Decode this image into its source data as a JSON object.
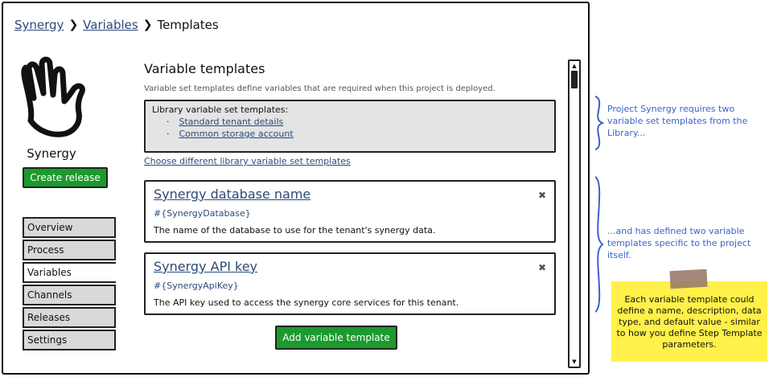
{
  "breadcrumb": {
    "items": [
      "Synergy",
      "Variables"
    ],
    "current": "Templates",
    "separator": "❯"
  },
  "project": {
    "name": "Synergy",
    "create_release_label": "Create release"
  },
  "nav": {
    "items": [
      "Overview",
      "Process",
      "Variables",
      "Channels",
      "Releases",
      "Settings"
    ],
    "active": "Variables"
  },
  "main": {
    "title": "Variable templates",
    "description": "Variable set templates define variables that are required when this project is deployed.",
    "library": {
      "heading": "Library variable set templates:",
      "bullet": "·",
      "items": [
        "Standard tenant details",
        "Common storage account"
      ]
    },
    "choose_link": "Choose different library variable set templates",
    "templates": [
      {
        "name": "Synergy database name",
        "variable": "#{SynergyDatabase}",
        "description": "The name of the database to use for the tenant's synergy data.",
        "close_icon": "✖"
      },
      {
        "name": "Synergy API key",
        "variable": "#{SynergyApiKey}",
        "description": "The API key used to access the synergy core services for this tenant.",
        "close_icon": "✖"
      }
    ],
    "add_button_label": "Add variable template"
  },
  "scrollbar": {
    "up_arrow": "▲",
    "down_arrow": "▼"
  },
  "annotations": {
    "library_note": "Project Synergy requires two variable set templates from the Library...",
    "project_note": "...and has defined two variable templates specific to the project itself.",
    "sticky_note": "Each variable template could define a name, description, data type, and default value - similar to how you define Step Template parameters."
  },
  "colors": {
    "accent_link": "#2c4a7a",
    "button_green": "#1c9a2e",
    "annotation_blue": "#3a63c9",
    "sticky_yellow": "#fff04a"
  }
}
